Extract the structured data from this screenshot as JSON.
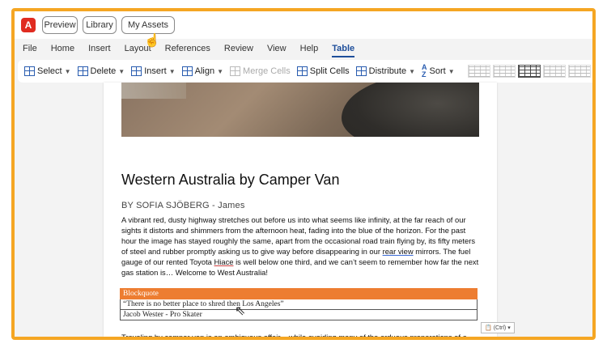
{
  "topbar": {
    "logo_glyph": "A",
    "buttons": [
      "Preview",
      "Library",
      "My Assets"
    ]
  },
  "ribbon": {
    "tabs": [
      "File",
      "Home",
      "Insert",
      "Layout",
      "References",
      "Review",
      "View",
      "Help",
      "Table"
    ],
    "active_tab": "Table"
  },
  "toolbar": {
    "select": "Select",
    "delete": "Delete",
    "insert": "Insert",
    "align": "Align",
    "merge": "Merge Cells",
    "split": "Split Cells",
    "distribute": "Distribute",
    "sort": "Sort",
    "sort_glyph_top": "A",
    "sort_glyph_bottom": "Z"
  },
  "document": {
    "title": "Western Australia by Camper Van",
    "byline": "BY SOFIA SJÖBERG - James",
    "para1_a": "A vibrant red, dusty highway stretches out before us into what seems like infinity, at the far reach of our sights it distorts and shimmers from the afternoon heat, fading into the blue of the horizon. For the past hour the image has stayed roughly the same, apart from the occasional road train flying by, its fifty meters of steel and rubber promptly asking us to give way before disappearing in our ",
    "para1_link": "rear view",
    "para1_b": " mirrors. The fuel gauge of our rented Toyota ",
    "para1_word": "Hiace",
    "para1_c": " is well below one third, and we can’t seem to remember how far the next gas station is… Welcome to West Australia!",
    "blockquote": {
      "header": "Blockquote",
      "quote": "“There is no better place to shred then Los Angeles”",
      "author": "Jacob Wester - Pro Skater"
    },
    "para2": "Traveling by camper van is an ambiguous affair – while avoiding many of the arduous preparations of a long journey, such as carefully planning ones stops, booking hotel nights and deciding what to do and see far in"
  },
  "paste_options": "(Ctrl) ▾",
  "colors": {
    "frame": "#f5a623",
    "accent_tab": "#1e4e9a",
    "blockquote_header": "#ed7d31"
  }
}
